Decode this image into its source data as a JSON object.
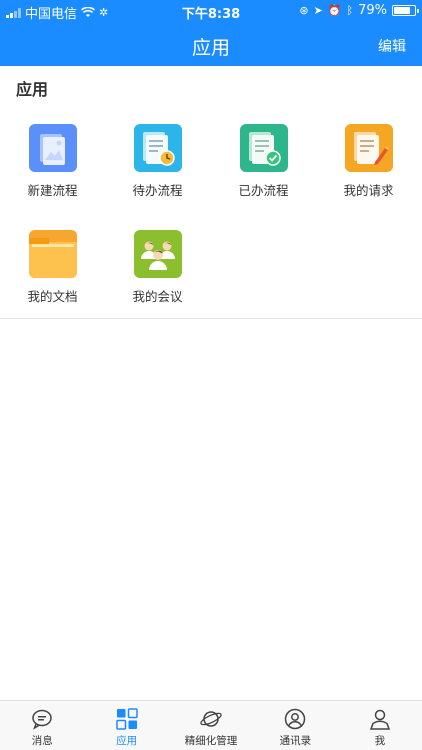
{
  "status": {
    "carrier": "中国电信",
    "time": "下午8:38",
    "battery": "79%",
    "battery_level": 0.79
  },
  "nav": {
    "title": "应用",
    "edit_label": "编辑"
  },
  "section": {
    "title": "应用"
  },
  "apps": [
    {
      "label": "新建流程",
      "icon": "image-doc-icon",
      "color": "#5b8ff9"
    },
    {
      "label": "待办流程",
      "icon": "pending-doc-icon",
      "color": "#2cb5e8"
    },
    {
      "label": "已办流程",
      "icon": "done-doc-icon",
      "color": "#2db68a"
    },
    {
      "label": "我的请求",
      "icon": "request-doc-icon",
      "color": "#f5a623"
    },
    {
      "label": "我的文档",
      "icon": "folder-icon",
      "color": "#f7a72d"
    },
    {
      "label": "我的会议",
      "icon": "meeting-icon",
      "color": "#8bbf2e"
    }
  ],
  "tabs": [
    {
      "label": "消息",
      "icon": "chat-icon",
      "active": false
    },
    {
      "label": "应用",
      "icon": "apps-icon",
      "active": true
    },
    {
      "label": "精细化管理",
      "icon": "planet-icon",
      "active": false
    },
    {
      "label": "通讯录",
      "icon": "contact-icon",
      "active": false
    },
    {
      "label": "我",
      "icon": "profile-icon",
      "active": false
    }
  ],
  "colors": {
    "primary": "#1a8cff"
  }
}
